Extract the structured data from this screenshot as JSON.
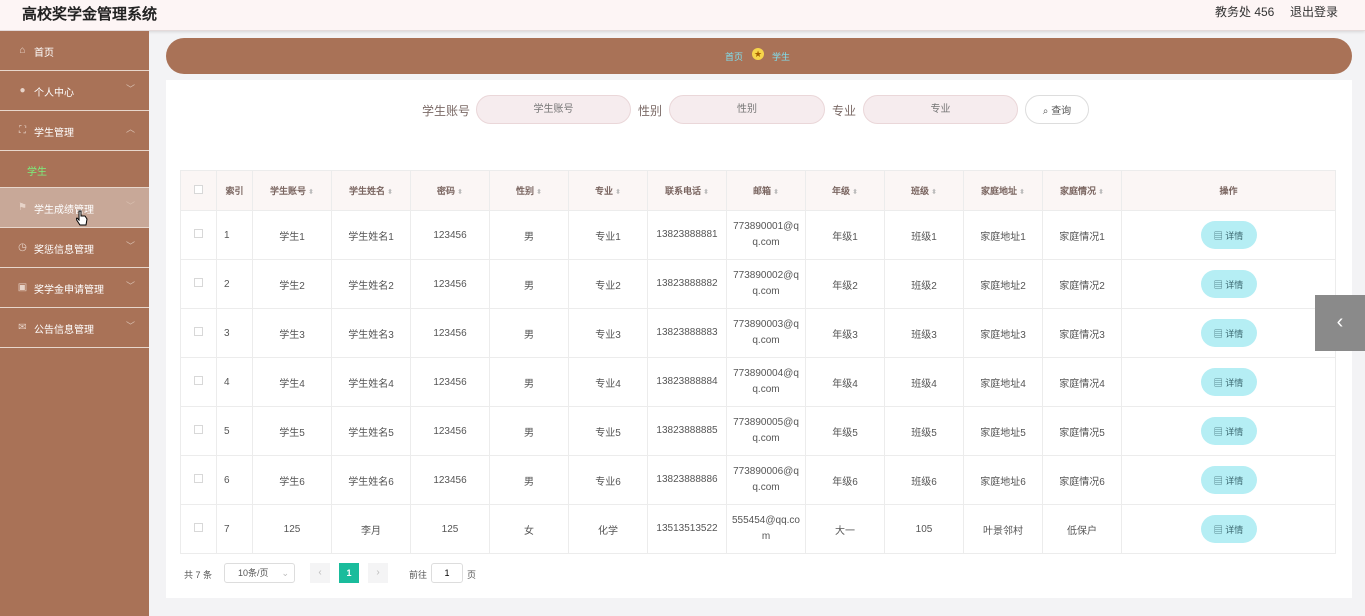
{
  "header": {
    "title": "高校奖学金管理系统",
    "user": "教务处 456",
    "logout": "退出登录"
  },
  "sidebar": {
    "items": [
      {
        "label": "首页",
        "icon": "home-icon"
      },
      {
        "label": "个人中心",
        "icon": "user-icon"
      },
      {
        "label": "学生管理",
        "icon": "frame-icon"
      },
      {
        "label": "学生成绩管理",
        "icon": "flag-icon"
      },
      {
        "label": "奖惩信息管理",
        "icon": "clock-icon"
      },
      {
        "label": "奖学金申请管理",
        "icon": "briefcase-icon"
      },
      {
        "label": "公告信息管理",
        "icon": "mail-icon"
      }
    ],
    "sub_item": "学生"
  },
  "breadcrumb": {
    "home": "首页",
    "current": "学生"
  },
  "search": {
    "account_label": "学生账号",
    "account_placeholder": "学生账号",
    "gender_label": "性别",
    "gender_placeholder": "性别",
    "major_label": "专业",
    "major_placeholder": "专业",
    "button": "查询"
  },
  "table": {
    "headers": [
      "索引",
      "学生账号",
      "学生姓名",
      "密码",
      "性别",
      "专业",
      "联系电话",
      "邮箱",
      "年级",
      "班级",
      "家庭地址",
      "家庭情况",
      "操作"
    ],
    "detail_label": "详情",
    "rows": [
      {
        "index": "1",
        "account": "学生1",
        "name": "学生姓名1",
        "password": "123456",
        "gender": "男",
        "major": "专业1",
        "phone": "13823888881",
        "email": "773890001@qq.com",
        "grade": "年级1",
        "class": "班级1",
        "address": "家庭地址1",
        "situation": "家庭情况1"
      },
      {
        "index": "2",
        "account": "学生2",
        "name": "学生姓名2",
        "password": "123456",
        "gender": "男",
        "major": "专业2",
        "phone": "13823888882",
        "email": "773890002@qq.com",
        "grade": "年级2",
        "class": "班级2",
        "address": "家庭地址2",
        "situation": "家庭情况2"
      },
      {
        "index": "3",
        "account": "学生3",
        "name": "学生姓名3",
        "password": "123456",
        "gender": "男",
        "major": "专业3",
        "phone": "13823888883",
        "email": "773890003@qq.com",
        "grade": "年级3",
        "class": "班级3",
        "address": "家庭地址3",
        "situation": "家庭情况3"
      },
      {
        "index": "4",
        "account": "学生4",
        "name": "学生姓名4",
        "password": "123456",
        "gender": "男",
        "major": "专业4",
        "phone": "13823888884",
        "email": "773890004@qq.com",
        "grade": "年级4",
        "class": "班级4",
        "address": "家庭地址4",
        "situation": "家庭情况4"
      },
      {
        "index": "5",
        "account": "学生5",
        "name": "学生姓名5",
        "password": "123456",
        "gender": "男",
        "major": "专业5",
        "phone": "13823888885",
        "email": "773890005@qq.com",
        "grade": "年级5",
        "class": "班级5",
        "address": "家庭地址5",
        "situation": "家庭情况5"
      },
      {
        "index": "6",
        "account": "学生6",
        "name": "学生姓名6",
        "password": "123456",
        "gender": "男",
        "major": "专业6",
        "phone": "13823888886",
        "email": "773890006@qq.com",
        "grade": "年级6",
        "class": "班级6",
        "address": "家庭地址6",
        "situation": "家庭情况6"
      },
      {
        "index": "7",
        "account": "125",
        "name": "李月",
        "password": "125",
        "gender": "女",
        "major": "化学",
        "phone": "13513513522",
        "email": "555454@qq.com",
        "grade": "大一",
        "class": "105",
        "address": "叶景邻村",
        "situation": "低保户"
      }
    ]
  },
  "pagination": {
    "total": "共 7 条",
    "page_size": "10条/页",
    "current_page": "1",
    "goto_label": "前往",
    "goto_value": "1",
    "page_unit": "页"
  },
  "colors": {
    "sidebar": "#a97257",
    "accent": "#1abc9c",
    "detail_button": "#b5eef4"
  }
}
